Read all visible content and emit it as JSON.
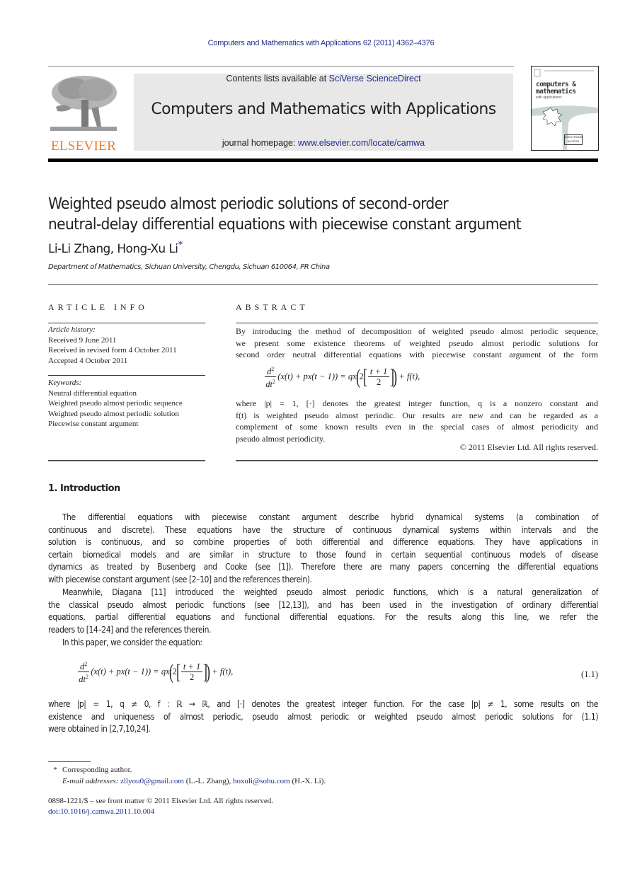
{
  "running_head": "Computers and Mathematics with Applications 62 (2011) 4362–4376",
  "header": {
    "publisher_logo": "ELSEVIER",
    "contents_prefix": "Contents lists available at ",
    "contents_link": "SciVerse ScienceDirect",
    "journal_title": "Computers and Mathematics with Applications",
    "homepage_prefix": "journal homepage: ",
    "homepage_link": "www.elsevier.com/locate/camwa",
    "cover": {
      "title_line1": "computers &",
      "title_line2": "mathematics",
      "subtitle": "with applications",
      "badge": "ELECTRONIC ACCESS"
    }
  },
  "article": {
    "title_line1": "Weighted pseudo almost periodic solutions of second-order",
    "title_line2": "neutral-delay differential equations with piecewise constant argument",
    "authors": "Li-Li Zhang, Hong-Xu Li",
    "author_mark": "*",
    "affiliation": "Department of Mathematics, Sichuan University, Chengdu, Sichuan 610064, PR China"
  },
  "article_info": {
    "heading": "ARTICLE INFO",
    "history_label": "Article history:",
    "history": [
      "Received 9 June 2011",
      "Received in revised form 4 October 2011",
      "Accepted 4 October 2011"
    ],
    "keywords_label": "Keywords:",
    "keywords": [
      "Neutral differential equation",
      "Weighted pseudo almost periodic sequence",
      "Weighted pseudo almost periodic solution",
      "Piecewise constant argument"
    ]
  },
  "abstract": {
    "heading": "ABSTRACT",
    "lines_before_eq": [
      "By introducing the method of decomposition of weighted pseudo almost periodic sequence,",
      "we present some existence theorems of weighted pseudo almost periodic solutions for",
      "second order neutral differential equations with piecewise constant argument of the form"
    ],
    "lines_after_eq": [
      "where |p| = 1, [·] denotes the greatest integer function, q is a nonzero constant and",
      "f(t) is weighted pseudo almost periodic. Our results are new and can be regarded as a",
      "complement of some known results even in the special cases of almost periodicity and",
      "pseudo almost periodicity."
    ],
    "copyright": "© 2011 Elsevier Ltd. All rights reserved."
  },
  "equation": {
    "d_num": "d",
    "d_num_sup": "2",
    "d_den": "dt",
    "d_den_sup": "2",
    "lhs": "(x(t) + px(t − 1)) = qx",
    "two": "2",
    "frac_num": "t + 1",
    "frac_den": "2",
    "rhs": "+ f(t),",
    "label": "(1.1)"
  },
  "introduction": {
    "heading": "1.  Introduction",
    "para1_lines": [
      "The differential equations with piecewise constant argument describe hybrid dynamical systems (a combination of",
      "continuous and discrete). These equations have the structure of continuous dynamical systems within intervals and the",
      "solution is continuous, and so combine properties of both differential and difference equations. They have applications in",
      "certain biomedical models and are similar in structure to those found in certain sequential continuous models of disease",
      "dynamics as treated by Busenberg and Cooke (see [1]). Therefore there are many papers concerning the differential equations",
      "with piecewise constant argument (see [2–10] and the references therein)."
    ],
    "para2_lines": [
      "Meanwhile, Diagana [11] introduced the weighted pseudo almost periodic functions, which is a natural generalization of",
      "the classical pseudo almost periodic functions (see [12,13]), and has been used in the investigation of ordinary differential",
      "equations, partial differential equations and functional differential equations. For the results along this line, we refer the",
      "readers to [14–24] and the references therein."
    ],
    "para3": "In this paper, we consider the equation:",
    "para4_lines": [
      "where |p| = 1, q ≠ 0, f : ℝ → ℝ, and [·] denotes the greatest integer function. For the case |p| ≠ 1, some results on the",
      "existence and uniqueness of almost periodic, pseudo almost periodic or weighted pseudo almost periodic solutions for (1.1)",
      "were obtained in [2,7,10,24]."
    ]
  },
  "footnotes": {
    "mark": "*",
    "corresponding": "Corresponding author.",
    "email_label": "E-mail addresses:",
    "email1": "zllyou0@gmail.com",
    "email1_owner": "(L.-L. Zhang),",
    "email2": "hoxuli@sohu.com",
    "email2_owner": "(H.-X. Li).",
    "front_matter": "0898-1221/$ – see front matter © 2011 Elsevier Ltd. All rights reserved.",
    "doi": "doi:10.1016/j.camwa.2011.10.004"
  }
}
